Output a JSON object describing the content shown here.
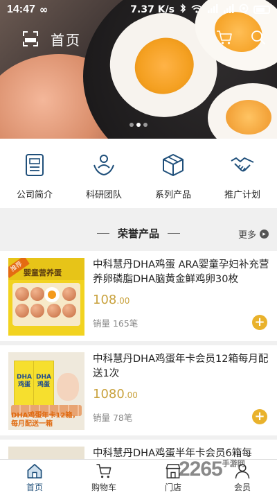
{
  "status_bar": {
    "time": "14:47",
    "infinity": "∞",
    "speed": "7.37 K/s",
    "icons": [
      "bluetooth-icon",
      "wifi-icon",
      "signal-icon",
      "signal-icon",
      "sync-icon",
      "battery-icon"
    ]
  },
  "header": {
    "title": "首页"
  },
  "banner": {
    "page_count": 3,
    "active_page": 2
  },
  "shortcuts": [
    {
      "label": "公司简介",
      "icon": "document-icon"
    },
    {
      "label": "科研团队",
      "icon": "team-icon"
    },
    {
      "label": "系列产品",
      "icon": "box-icon"
    },
    {
      "label": "推广计划",
      "icon": "handshake-icon"
    }
  ],
  "section": {
    "title": "荣誉产品",
    "more_label": "更多"
  },
  "products": [
    {
      "name": "中科慧丹DHA鸡蛋 ARA婴童孕妇补充营养卵磷脂DHA脑黄金鲜鸡卵30枚",
      "price_main": "108",
      "price_cents": ".00",
      "sold": "销量 165笔",
      "thumb_tag": "推荐",
      "thumb_title": "婴童营养蛋"
    },
    {
      "name": "中科慧丹DHA鸡蛋年卡会员12箱每月配送1次",
      "price_main": "1080",
      "price_cents": ".00",
      "sold": "销量 78笔",
      "thumb_box_text": "DHA鸡蛋",
      "thumb_caption": "DHA鸡蛋年卡12箱，每月配送一箱"
    },
    {
      "name": "中科慧丹DHA鸡蛋半年卡会员6箱每"
    }
  ],
  "bottom_nav": [
    {
      "label": "首页",
      "icon": "home-icon",
      "active": true
    },
    {
      "label": "购物车",
      "icon": "cart-icon",
      "active": false
    },
    {
      "label": "门店",
      "icon": "store-icon",
      "active": false
    },
    {
      "label": "会员",
      "icon": "member-icon",
      "active": false
    }
  ],
  "watermark": {
    "text": "2265",
    "sub": "手游网"
  },
  "colors": {
    "brand_navy": "#1f4f7a",
    "price_gold": "#c9a23e",
    "add_button": "#e9b22c"
  }
}
